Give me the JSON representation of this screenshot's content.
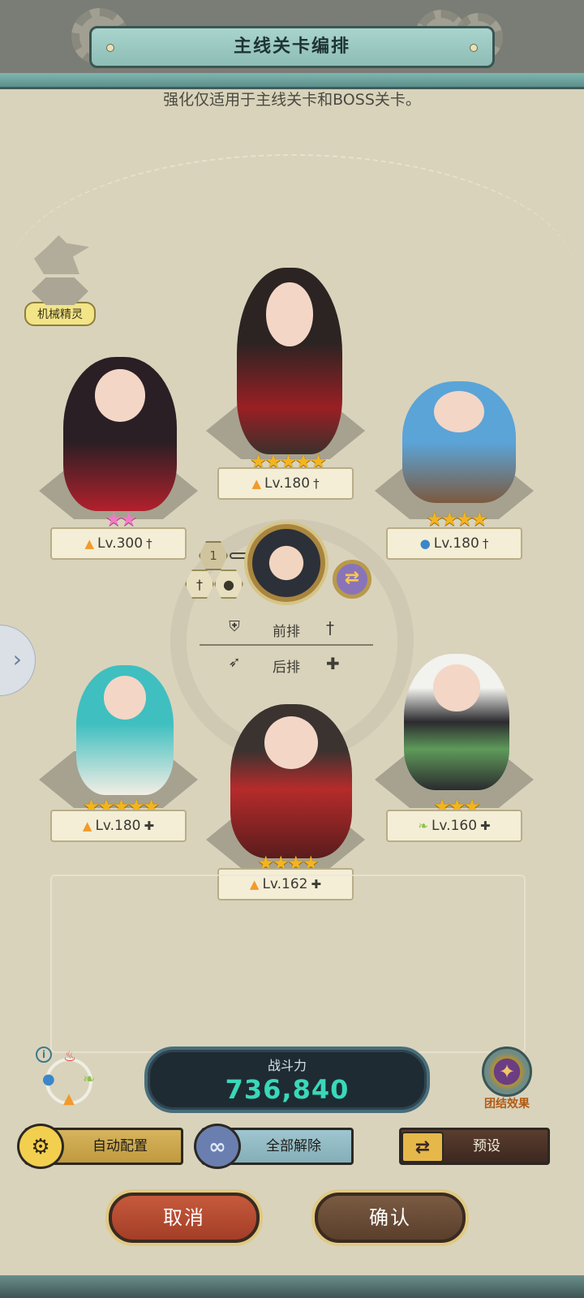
{
  "title": "主线关卡编排",
  "notice": "强化仅适用于主线关卡和BOSS关卡。",
  "mech_spirit": {
    "label": "机械精灵"
  },
  "heroes": [
    {
      "id": "front-left",
      "level": "Lv.300",
      "stars": "★★",
      "star_color": "#f07cc6",
      "element_icon": "fire-icon",
      "role_icon": "sword-icon"
    },
    {
      "id": "front-center",
      "level": "Lv.180",
      "stars": "★★★★★",
      "star_color": "#f3b51f",
      "element_icon": "fire-icon",
      "role_icon": "sword-icon"
    },
    {
      "id": "front-right",
      "level": "Lv.180",
      "stars": "★★★★",
      "star_color": "#f3b51f",
      "element_icon": "water-icon",
      "role_icon": "sword-icon"
    },
    {
      "id": "back-left",
      "level": "Lv.180",
      "stars": "★★★★★",
      "star_color": "#f3b51f",
      "element_icon": "fire-icon",
      "role_icon": "plus-icon"
    },
    {
      "id": "back-center",
      "level": "Lv.162",
      "stars": "★★★★",
      "star_color": "#f3b51f",
      "element_icon": "fire-icon",
      "role_icon": "plus-icon"
    },
    {
      "id": "back-right",
      "level": "Lv.160",
      "stars": "★★★",
      "star_color": "#f3b51f",
      "element_icon": "wind-icon",
      "role_icon": "plus-icon"
    }
  ],
  "leader": {
    "rank": "1"
  },
  "rows": {
    "front": {
      "label": "前排"
    },
    "back": {
      "label": "后排"
    }
  },
  "combat_power": {
    "label": "战斗力",
    "value": "736,840"
  },
  "team_effect": {
    "label": "团结效果"
  },
  "buttons": {
    "auto": "自动配置",
    "clear": "全部解除",
    "preset": "预设",
    "cancel": "取消",
    "confirm": "确认"
  },
  "colors": {
    "accent_teal": "#39d8b9",
    "panel": "#d9d3bc",
    "cancel": "#b44a30",
    "confirm": "#6a4c37"
  }
}
